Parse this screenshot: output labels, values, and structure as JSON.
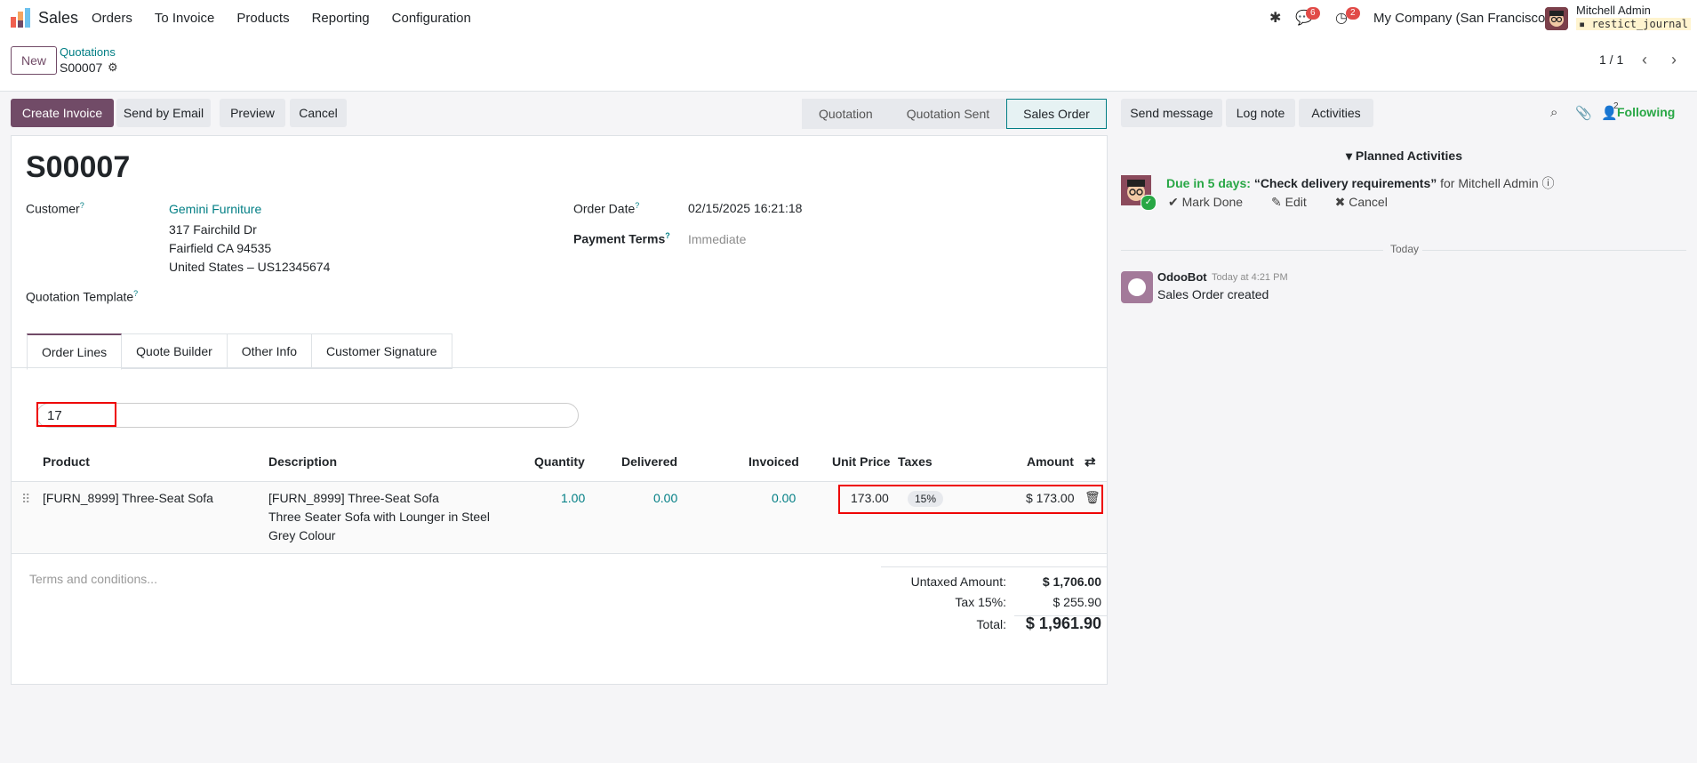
{
  "nav": {
    "app_name": "Sales",
    "menu": [
      "Orders",
      "To Invoice",
      "Products",
      "Reporting",
      "Configuration"
    ],
    "messages_count": "6",
    "activities_count": "2",
    "company": "My Company (San Francisco)",
    "user_name": "Mitchell Admin",
    "db_name": "restict_journal"
  },
  "control": {
    "new_label": "New",
    "breadcrumb_parent": "Quotations",
    "breadcrumb_current": "S00007",
    "pager": "1 / 1"
  },
  "actions": {
    "create_invoice": "Create Invoice",
    "send_email": "Send by Email",
    "preview": "Preview",
    "cancel": "Cancel"
  },
  "statusbar": [
    "Quotation",
    "Quotation Sent",
    "Sales Order"
  ],
  "form": {
    "title": "S00007",
    "customer_label": "Customer",
    "customer_name": "Gemini Furniture",
    "address_line1": "317 Fairchild Dr",
    "address_line2": "Fairfield CA 94535",
    "address_line3": "United States – US12345674",
    "order_date_label": "Order Date",
    "order_date": "02/15/2025 16:21:18",
    "payment_terms_label": "Payment Terms",
    "payment_terms": "Immediate",
    "template_label": "Quotation Template"
  },
  "tabs": [
    "Order Lines",
    "Quote Builder",
    "Other Info",
    "Customer Signature"
  ],
  "search_value": "17",
  "table": {
    "headers": {
      "product": "Product",
      "description": "Description",
      "quantity": "Quantity",
      "delivered": "Delivered",
      "invoiced": "Invoiced",
      "unit_price": "Unit Price",
      "taxes": "Taxes",
      "amount": "Amount"
    },
    "row": {
      "product": "[FURN_8999] Three-Seat Sofa",
      "desc1": "[FURN_8999] Three-Seat Sofa",
      "desc2": "Three Seater Sofa with Lounger in Steel",
      "desc3": "Grey Colour",
      "quantity": "1.00",
      "delivered": "0.00",
      "invoiced": "0.00",
      "unit_price": "173.00",
      "tax": "15%",
      "amount": "$ 173.00"
    }
  },
  "terms_placeholder": "Terms and conditions...",
  "totals": {
    "untaxed_label": "Untaxed Amount:",
    "untaxed": "$ 1,706.00",
    "tax_label": "Tax 15%:",
    "tax": "$ 255.90",
    "total_label": "Total:",
    "total": "$ 1,961.90"
  },
  "chatter": {
    "send_message": "Send message",
    "log_note": "Log note",
    "activities": "Activities",
    "followers_count": "2",
    "following": "Following",
    "planned_title": "Planned Activities",
    "due_label": "Due in 5 days:",
    "activity_summary": "“Check delivery requirements”",
    "activity_for": "for Mitchell Admin",
    "mark_done": "Mark Done",
    "edit": "Edit",
    "cancel": "Cancel",
    "today": "Today",
    "bot_name": "OdooBot",
    "bot_time": "Today at 4:21 PM",
    "bot_message": "Sales Order created"
  }
}
